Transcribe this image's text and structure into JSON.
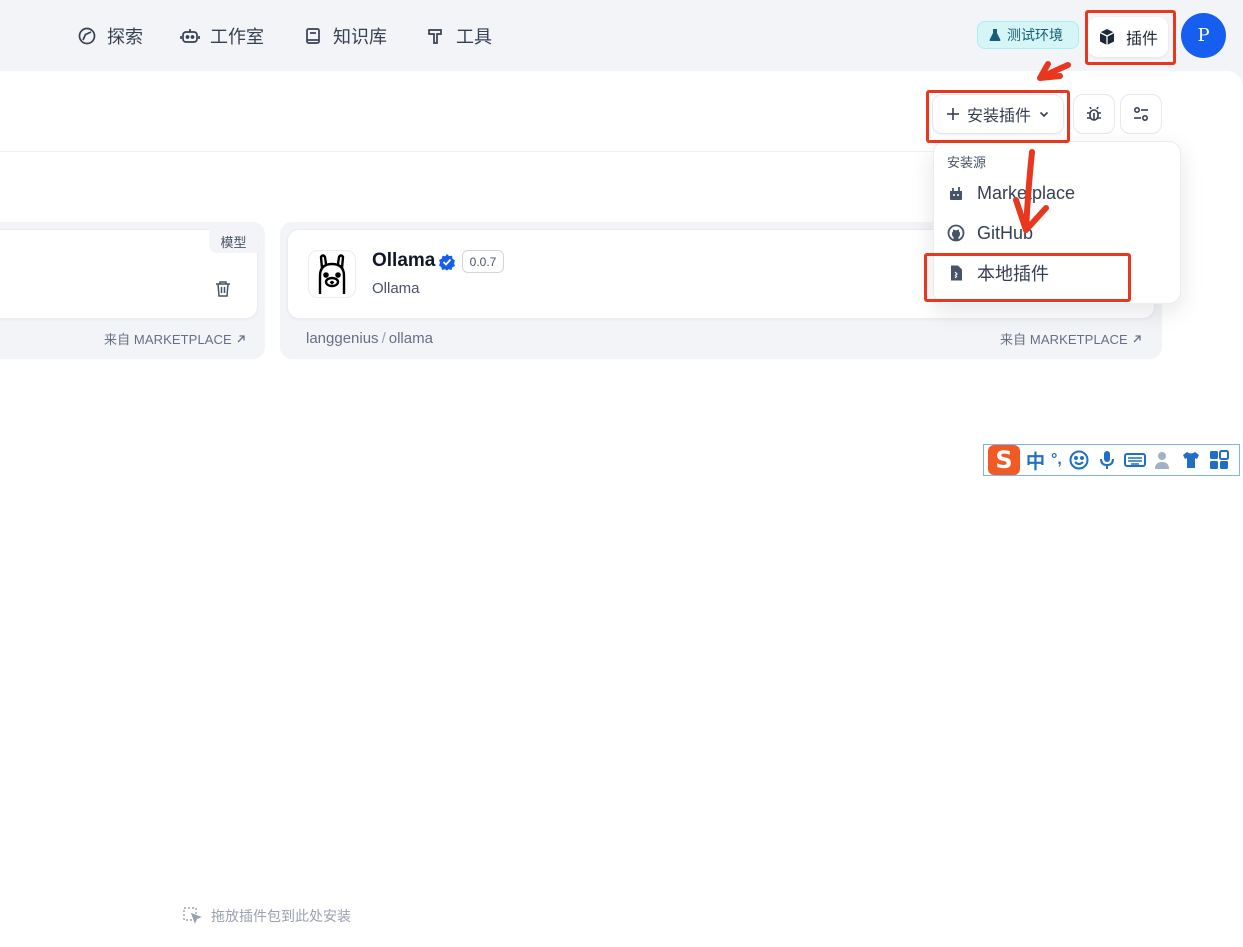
{
  "header": {
    "nav": [
      {
        "label": "探索",
        "icon": "compass-icon"
      },
      {
        "label": "工作室",
        "icon": "robot-icon"
      },
      {
        "label": "知识库",
        "icon": "book-icon"
      },
      {
        "label": "工具",
        "icon": "hammer-icon"
      }
    ],
    "env_badge": "测试环境",
    "plugins_label": "插件",
    "avatar_initial": "P"
  },
  "toolbar": {
    "install_label": "安装插件"
  },
  "install_menu": {
    "title": "安装源",
    "items": [
      {
        "label": "Marketplace",
        "icon": "marketplace-icon"
      },
      {
        "label": "GitHub",
        "icon": "github-icon"
      },
      {
        "label": "本地插件",
        "icon": "local-file-icon"
      }
    ]
  },
  "cards": [
    {
      "tag": "模型",
      "source": "来自 MARKETPLACE"
    },
    {
      "name": "Ollama",
      "version": "0.0.7",
      "subtitle": "Ollama",
      "org": "langgenius",
      "repo": "ollama",
      "source": "来自 MARKETPLACE"
    }
  ],
  "ime": {
    "logo": "S",
    "mode": "中",
    "punct": "°,"
  },
  "drop_hint": "拖放插件包到此处安装",
  "colors": {
    "accent": "#155eef",
    "annotation": "#e8371f",
    "verified": "#155eef"
  }
}
